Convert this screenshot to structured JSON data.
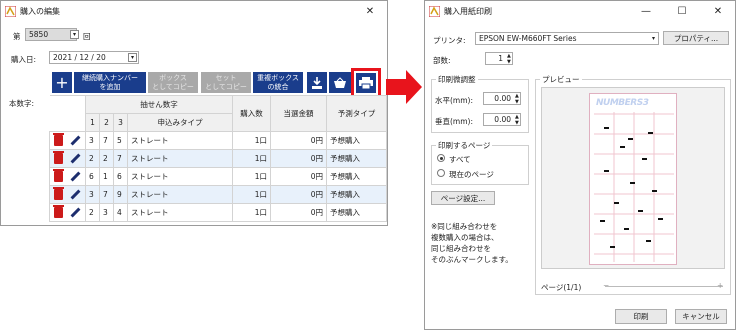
{
  "left_window": {
    "title": "購入の編集",
    "round_label": "第",
    "round_value": "5850",
    "round_suffix": "回",
    "date_label": "購入日:",
    "date_value": "2021 / 12 / 20",
    "toolbar": {
      "add_label": "+",
      "continue_label": "継続購入ナンバー\nを追加",
      "box_label": "ボックス\nとしてコピー",
      "set_label": "セット\nとしてコピー",
      "merge_label": "重複ボックス\nの統合"
    },
    "count_label": "本数字:",
    "table": {
      "header_numbers": "抽せん数字",
      "header_cols": [
        "1",
        "2",
        "3"
      ],
      "header_type": "申込みタイプ",
      "header_qty": "購入数",
      "header_prize": "当選金額",
      "header_pred": "予測タイプ",
      "rows": [
        {
          "n1": "3",
          "n2": "7",
          "n3": "5",
          "type": "ストレート",
          "qty": "1口",
          "prize": "0円",
          "pred": "予想購入"
        },
        {
          "n1": "2",
          "n2": "2",
          "n3": "7",
          "type": "ストレート",
          "qty": "1口",
          "prize": "0円",
          "pred": "予想購入"
        },
        {
          "n1": "6",
          "n2": "1",
          "n3": "6",
          "type": "ストレート",
          "qty": "1口",
          "prize": "0円",
          "pred": "予想購入"
        },
        {
          "n1": "3",
          "n2": "7",
          "n3": "9",
          "type": "ストレート",
          "qty": "1口",
          "prize": "0円",
          "pred": "予想購入"
        },
        {
          "n1": "2",
          "n2": "3",
          "n3": "4",
          "type": "ストレート",
          "qty": "1口",
          "prize": "0円",
          "pred": "予想購入"
        }
      ]
    }
  },
  "right_window": {
    "title": "購入用紙印刷",
    "printer_label": "プリンタ:",
    "printer_value": "EPSON EW-M660FT Series",
    "properties_label": "プロパティ...",
    "copies_label": "部数:",
    "copies_value": "1",
    "adjust_label": "印刷微調整",
    "horizontal_label": "水平(mm):",
    "horizontal_value": "0.00",
    "vertical_label": "垂直(mm):",
    "vertical_value": "0.00",
    "pages_label": "印刷するページ",
    "radio_all": "すべて",
    "radio_current": "現在のページ",
    "page_setup_label": "ページ設定...",
    "note": "※同じ組み合わせを\n複数購入の場合は、\n同じ組み合わせを\nそのぶんマークします。",
    "preview_label": "プレビュー",
    "preview_logo": "NUMBERS3",
    "page_indicator": "ページ(1/1)",
    "print_button": "印刷",
    "cancel_button": "キャンセル"
  },
  "colors": {
    "accent_blue": "#1a3d8c",
    "red_arrow": "#e8141c",
    "trash_red": "#cc1a1a",
    "row_highlight": "#e8f1fb"
  }
}
